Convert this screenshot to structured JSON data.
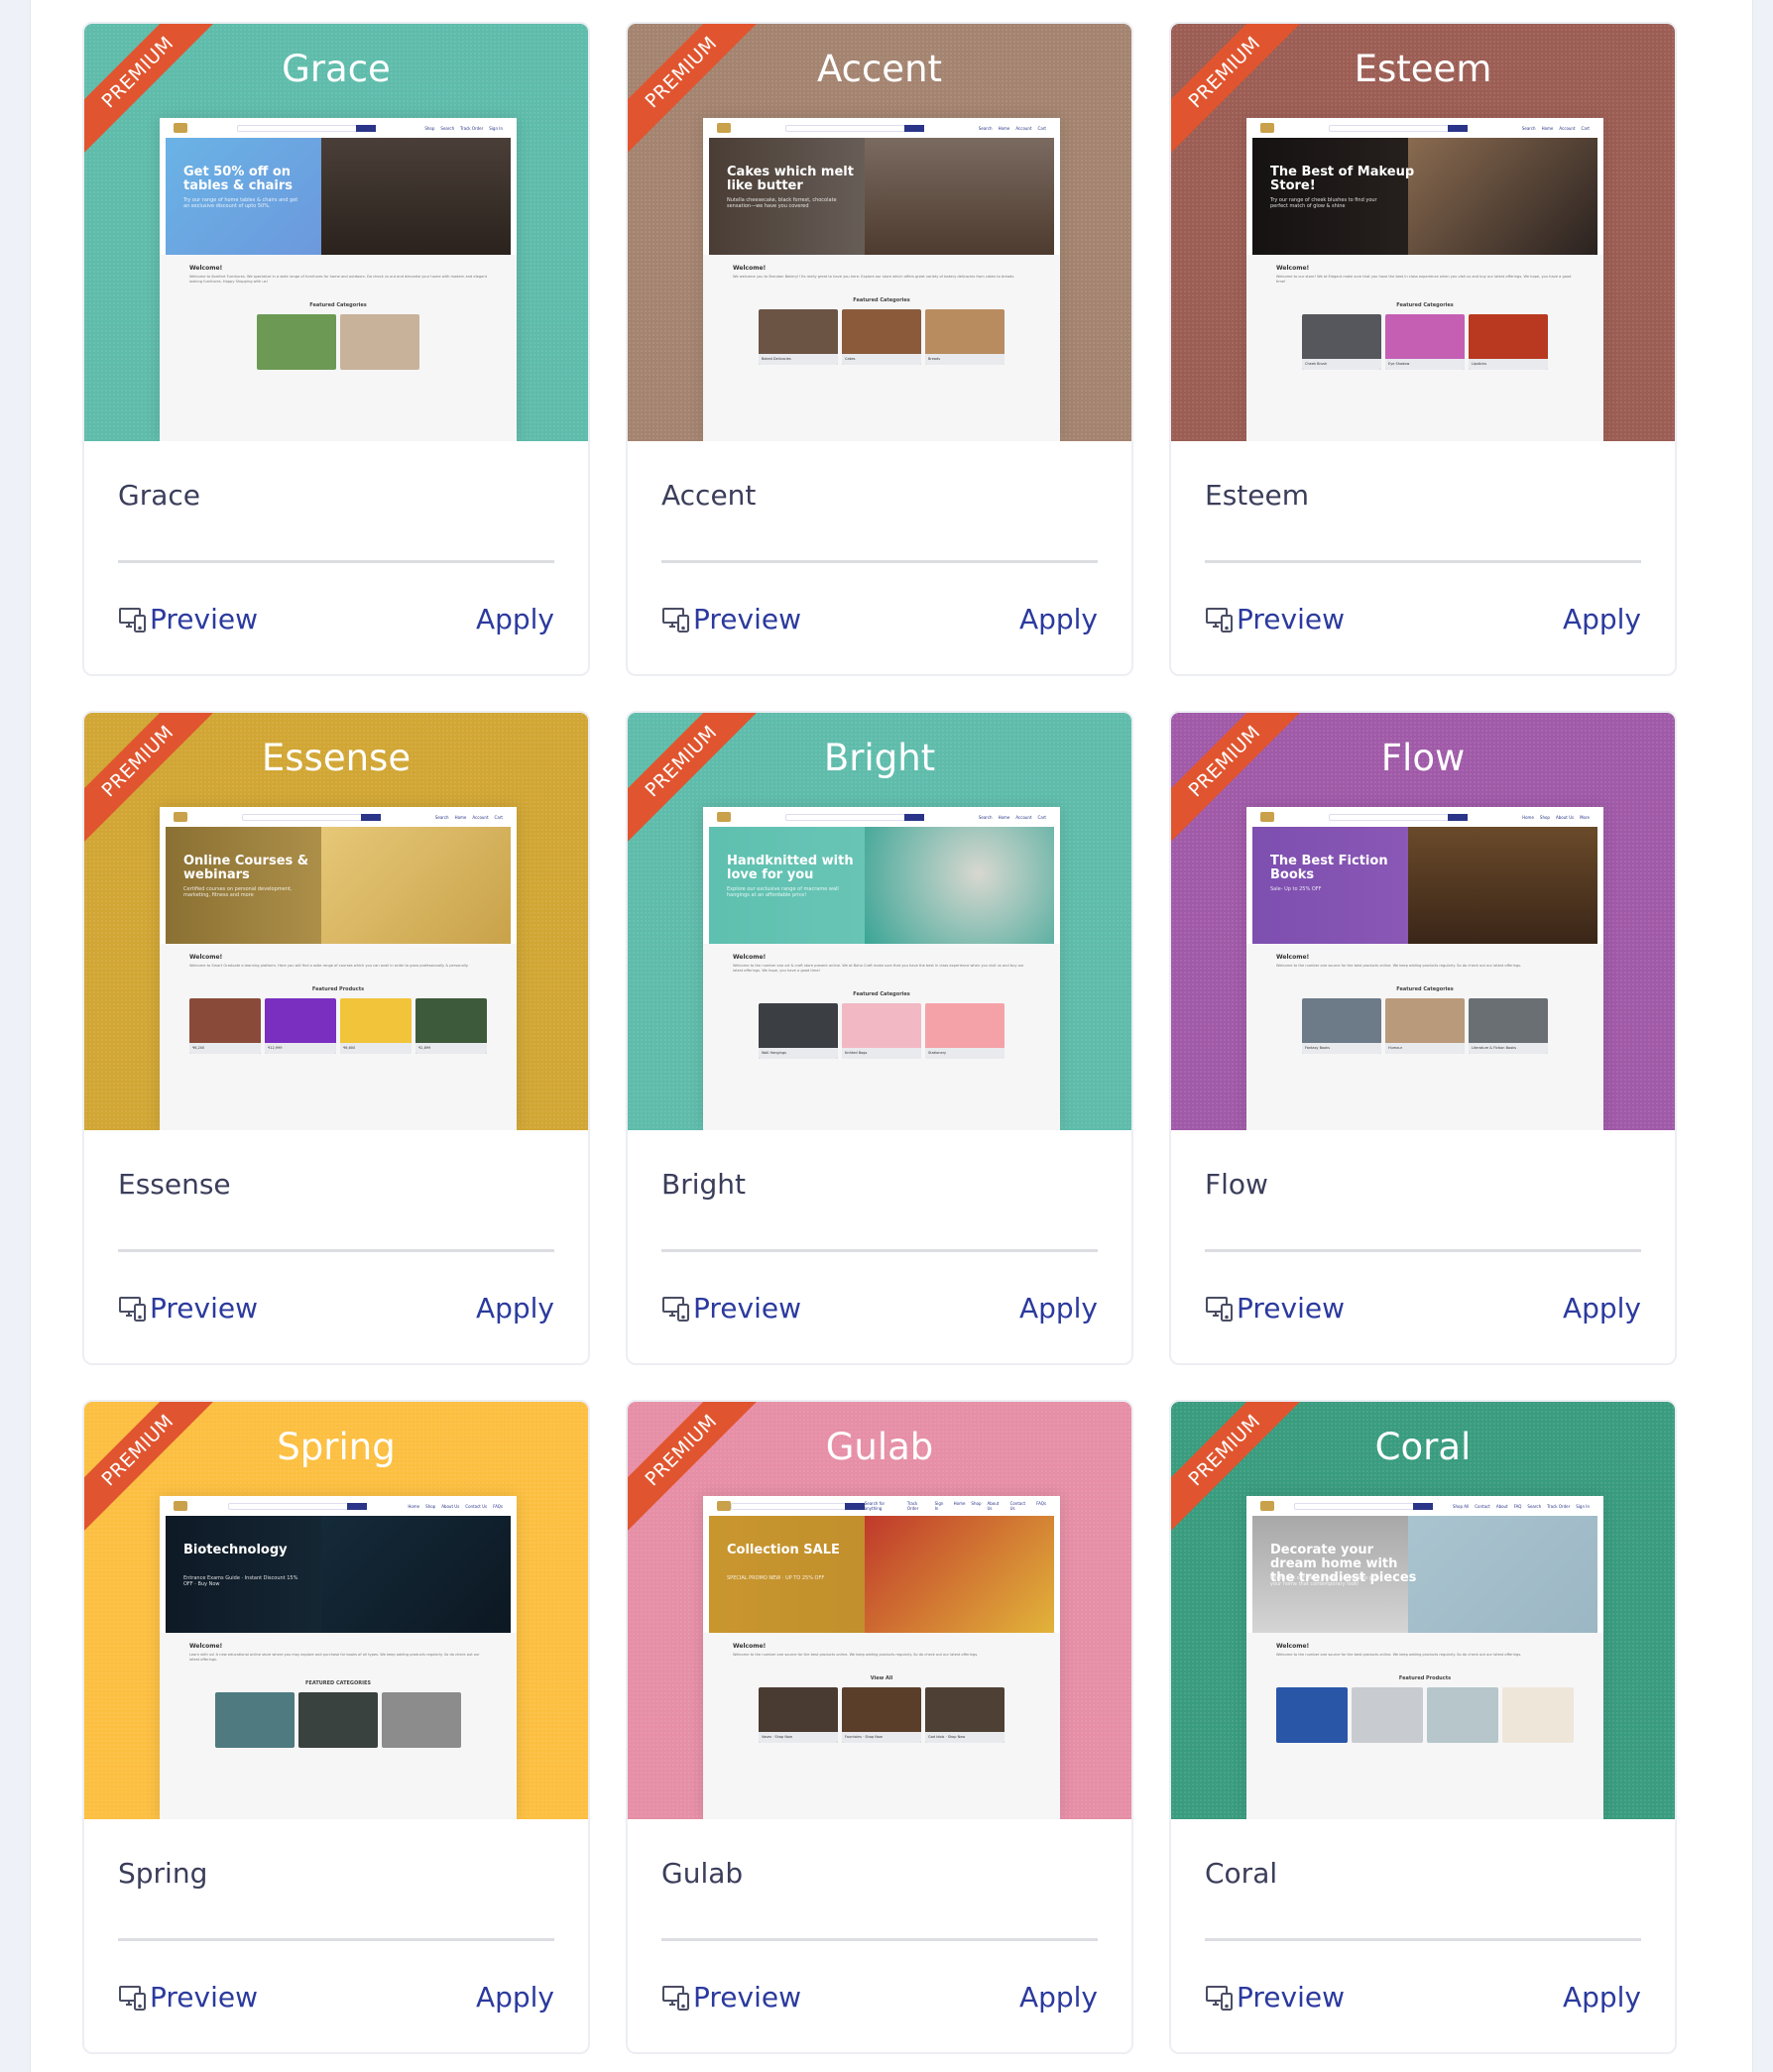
{
  "ribbon_label": "PREMIUM",
  "actions": {
    "preview_label": "Preview",
    "apply_label": "Apply"
  },
  "colors": {
    "ribbon": "#e0552f",
    "link": "#2b3a9e",
    "name_text": "#3b3e5a"
  },
  "templates": [
    {
      "name": "Grace",
      "header_color": "#5fbcab",
      "preview": {
        "nav": [
          "Shop",
          "Search",
          "Track Order",
          "Sign In"
        ],
        "hero_title": "Get 50% off on tables & chairs",
        "hero_sub": "Try our range of home tables & chairs and get an exclusive discount of upto 50%.",
        "hero_bg": "linear-gradient(135deg,#6ab3e6,#6d86d6)",
        "art_bg": "linear-gradient(180deg,#4a3f38,#2b221d)",
        "welcome": "Welcome!",
        "welcome_text": "Welcome to Komfort Furnitures. We specialize in a wide range of furnitures for home and outdoors. Do check us out and decorate your home with modern and elegant looking furnitures. Happy Shopping with us!",
        "featured": "Featured Categories",
        "tiles": [
          {
            "label": "",
            "color": "#6c9a55"
          },
          {
            "label": "",
            "color": "#c8b29a"
          }
        ]
      }
    },
    {
      "name": "Accent",
      "header_color": "#a48470",
      "preview": {
        "nav": [
          "Search",
          "Home",
          "Account",
          "Cart"
        ],
        "hero_title": "Cakes which melt like butter",
        "hero_sub": "Nutella cheesecake, black forrest, chocolate sensation—we have you covered",
        "hero_bg": "linear-gradient(90deg,#4a3d35,#8a8580)",
        "art_bg": "linear-gradient(180deg,#7a6a60,#4e3b2f)",
        "welcome": "Welcome!",
        "welcome_text": "We welcome you to Brandon Bakery!! Its really great to have you here. Explore our store which offers great variety of bakery delicacies from cakes to breads.",
        "featured": "Featured Categories",
        "tiles": [
          {
            "label": "Baked Delicacies",
            "color": "#6b5444"
          },
          {
            "label": "Cakes",
            "color": "#8a5a3b"
          },
          {
            "label": "Breads",
            "color": "#b88c5f"
          }
        ]
      }
    },
    {
      "name": "Esteem",
      "header_color": "#9c5e54",
      "preview": {
        "nav": [
          "Search",
          "Home",
          "Account",
          "Cart"
        ],
        "hero_title": "The Best of Makeup Store!",
        "hero_sub": "Try our range of cheek blushes to find your perfect match of glow & shine",
        "hero_bg": "linear-gradient(90deg,#151212,#3a302a)",
        "art_bg": "linear-gradient(135deg,#8a6b50,#2a2220)",
        "welcome": "Welcome!",
        "welcome_text": "Welcome to our store! We at Elegant make sure that you have the best in class experience when you visit us and buy our latest offerings. We hope, you have a good time!",
        "featured": "Featured Categories",
        "tiles": [
          {
            "label": "Cheek Brush",
            "color": "#55575c"
          },
          {
            "label": "Eye Shadow",
            "color": "#c45fb4"
          },
          {
            "label": "Lipsticks",
            "color": "#b8391f"
          }
        ]
      }
    },
    {
      "name": "Essense",
      "header_color": "#d1a634",
      "preview": {
        "nav": [
          "Search",
          "Home",
          "Account",
          "Cart"
        ],
        "hero_title": "Online Courses & webinars",
        "hero_sub": "Certified courses on personal development, marketing, fitness and more",
        "hero_bg": "linear-gradient(90deg,#8a7033,#d7b563)",
        "art_bg": "linear-gradient(135deg,#e6c878,#c9a24a)",
        "welcome": "Welcome!",
        "welcome_text": "Welcome to Smart Graduate e-learning platform. Here you will find a wide range of courses which you can avail in order to grow professionally & personally.",
        "featured": "Featured Products",
        "tiles": [
          {
            "label": "₹6,200",
            "color": "#8a4a3a"
          },
          {
            "label": "₹12,999",
            "color": "#7a2fc0"
          },
          {
            "label": "₹6,600",
            "color": "#f2c43a"
          },
          {
            "label": "₹2,899",
            "color": "#3d5a3b"
          }
        ]
      }
    },
    {
      "name": "Bright",
      "header_color": "#5fbcab",
      "preview": {
        "nav": [
          "Search",
          "Home",
          "Account",
          "Cart"
        ],
        "hero_title": "Handknitted with love for you",
        "hero_sub": "Explore our exclusive range of macrame wall hangings at an affordable price!",
        "hero_bg": "linear-gradient(90deg,#5ec0b0,#75cbbd)",
        "art_bg": "radial-gradient(circle at 60% 40%,#d8d8d0,#3aa596)",
        "welcome": "Welcome!",
        "welcome_text": "Welcome to the number one art & craft store present online. We at Boho Craft make sure that you have the best in class experience when you visit us and buy our latest offerings. We hope, you have a good time!",
        "featured": "Featured Categories",
        "tiles": [
          {
            "label": "Wall Hangings",
            "color": "#3b3f44"
          },
          {
            "label": "Knitted Bags",
            "color": "#f2b8c4"
          },
          {
            "label": "Stationery",
            "color": "#f4a2a8"
          }
        ]
      }
    },
    {
      "name": "Flow",
      "header_color": "#a05aa8",
      "preview": {
        "nav": [
          "Home",
          "Shop",
          "About Us",
          "More"
        ],
        "hero_title": "The Best Fiction Books",
        "hero_sub": "Sale- Up to 25% OFF",
        "hero_bg": "linear-gradient(90deg,#7d4fb0,#9a62bc)",
        "art_bg": "linear-gradient(180deg,#6a4a2a,#3a2618)",
        "welcome": "Welcome!",
        "welcome_text": "Welcome to the number one source for the best products online. We keep adding products regularly. So do check out our latest offerings.",
        "featured": "Featured Categories",
        "tiles": [
          {
            "label": "Fantasy Books",
            "color": "#6d7a88"
          },
          {
            "label": "Humour",
            "color": "#b99a7a"
          },
          {
            "label": "Literature & Fiction Books",
            "color": "#6a6f74"
          }
        ]
      }
    },
    {
      "name": "Spring",
      "header_color": "#fcbf41",
      "preview": {
        "nav": [
          "Home",
          "Shop",
          "About Us",
          "Contact Us",
          "FAQs"
        ],
        "hero_title": "Biotechnology",
        "hero_sub": "Entrance Exams Guide · Instant Discount 15% OFF · Buy Now",
        "hero_bg": "linear-gradient(90deg,#0e1a26,#1d3444)",
        "art_bg": "linear-gradient(135deg,#152a3a,#0c1822)",
        "welcome": "Welcome!",
        "welcome_text": "Learn with us! A new educational online store where you may explore and purchase for books of all types. We keep adding products regularly. So do check out our latest offerings.",
        "featured": "FEATURED CATEGORIES",
        "tiles": [
          {
            "label": "",
            "color": "#4e7a80"
          },
          {
            "label": "",
            "color": "#3a4240"
          },
          {
            "label": "",
            "color": "#8c8c8c"
          }
        ]
      }
    },
    {
      "name": "Gulab",
      "header_color": "#e68fa6",
      "preview": {
        "nav": [
          "Search for anything",
          "Track Order",
          "Sign In",
          "Home",
          "Shop",
          "About Us",
          "Contact Us",
          "FAQs"
        ],
        "hero_title": "Collection SALE",
        "hero_sub": "SPECIAL PROMO NEW · UP TO 25% OFF",
        "hero_bg": "linear-gradient(90deg,#c9962e,#b8892b)",
        "art_bg": "linear-gradient(135deg,#c0392b,#e2b43a)",
        "welcome": "Welcome!",
        "welcome_text": "Welcome to the number one source for the best products online. We keep adding products regularly. So do check out our latest offerings.",
        "featured": "View All",
        "tiles": [
          {
            "label": "Vases · Shop Now",
            "color": "#4a3b32"
          },
          {
            "label": "Fountains · Shop Now",
            "color": "#5a3e2a"
          },
          {
            "label": "God Idols · Shop Now",
            "color": "#4e4034"
          }
        ]
      }
    },
    {
      "name": "Coral",
      "header_color": "#3a9c7f",
      "preview": {
        "nav": [
          "Shop All",
          "Contact",
          "About",
          "FAQ",
          "Search",
          "Track Order",
          "Sign In"
        ],
        "hero_title": "Decorate your dream home with the trendiest pieces",
        "hero_sub": "Check out our sleek lounge furniture to give your home that contemporary look!",
        "hero_bg": "linear-gradient(180deg,#a8a8a8,#d5d5d5)",
        "art_bg": "linear-gradient(135deg,#a9c4cf,#9cb7c4)",
        "welcome": "Welcome!",
        "welcome_text": "Welcome to the number one source for the best products online. We keep adding products regularly. So do check out our latest offerings.",
        "featured": "Featured Products",
        "tiles": [
          {
            "label": "",
            "color": "#2a56a8"
          },
          {
            "label": "",
            "color": "#c8ccd0"
          },
          {
            "label": "",
            "color": "#b6c6ca"
          },
          {
            "label": "",
            "color": "#efe6da"
          }
        ]
      }
    }
  ]
}
